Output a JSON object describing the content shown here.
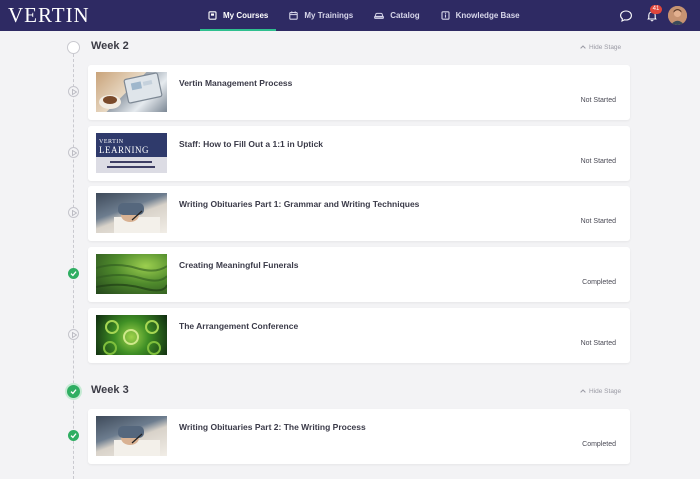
{
  "app": {
    "logo": "VERTIN",
    "notification_count": "41",
    "accent_color": "#2fbf8f",
    "nav_color": "#2e2a63"
  },
  "nav": [
    {
      "label": "My Courses",
      "icon": "book-icon",
      "active": true
    },
    {
      "label": "My Trainings",
      "icon": "calendar-icon",
      "active": false
    },
    {
      "label": "Catalog",
      "icon": "car-icon",
      "active": false
    },
    {
      "label": "Knowledge Base",
      "icon": "info-book-icon",
      "active": false
    }
  ],
  "stages": [
    {
      "title": "Week 2",
      "hide_label": "Hide Stage",
      "completed": false,
      "courses": [
        {
          "title": "Vertin Management Process",
          "status": "Not Started",
          "completed": false,
          "thumb": "laptop"
        },
        {
          "title": "Staff: How to Fill Out a 1:1 in Uptick",
          "status": "Not Started",
          "completed": false,
          "thumb": "learning"
        },
        {
          "title": "Writing Obituaries Part 1: Grammar and Writing Techniques",
          "status": "Not Started",
          "completed": false,
          "thumb": "writing"
        },
        {
          "title": "Creating Meaningful Funerals",
          "status": "Completed",
          "completed": true,
          "thumb": "tea"
        },
        {
          "title": "The Arrangement Conference",
          "status": "Not Started",
          "completed": false,
          "thumb": "leaves"
        }
      ]
    },
    {
      "title": "Week 3",
      "hide_label": "Hide Stage",
      "completed": true,
      "courses": [
        {
          "title": "Writing Obituaries Part 2: The Writing Process",
          "status": "Completed",
          "completed": true,
          "thumb": "writing"
        }
      ]
    }
  ],
  "thumbnails": {
    "learning_line1": "VERTIN",
    "learning_line2": "LEARNING"
  }
}
